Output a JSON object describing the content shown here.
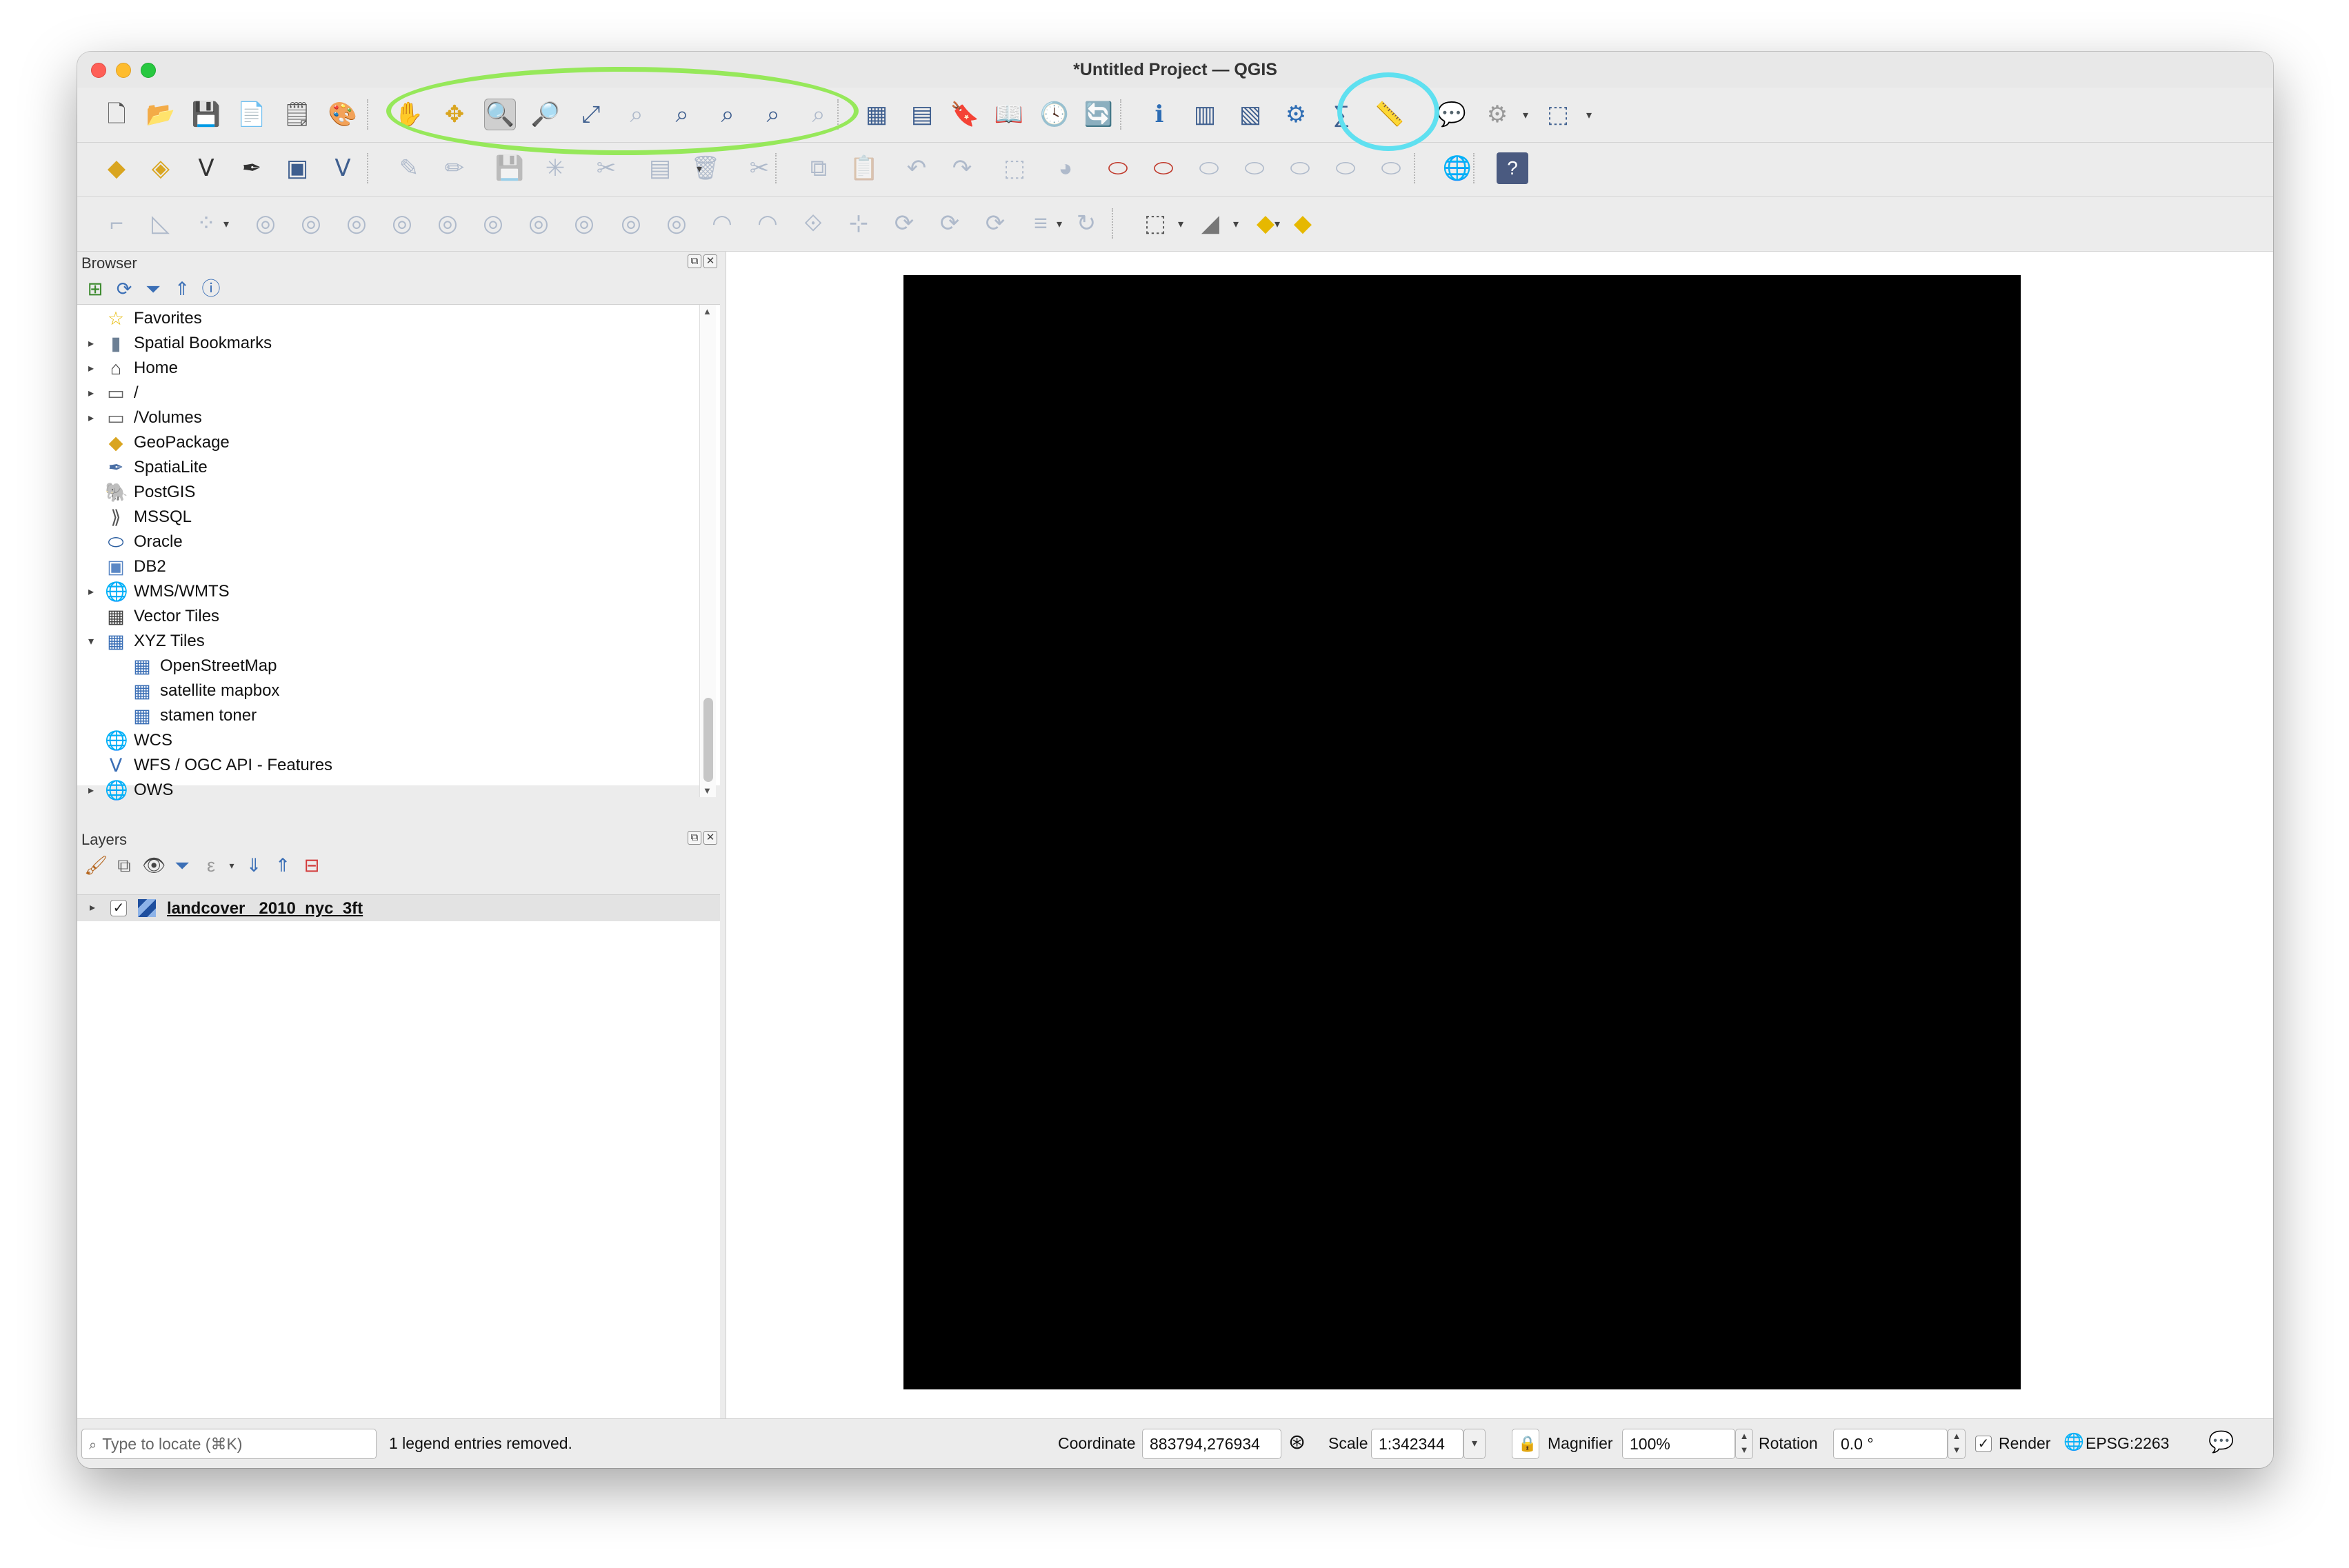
{
  "window": {
    "title": "*Untitled Project — QGIS"
  },
  "toolbar1": {
    "tools": [
      {
        "name": "new-project-icon",
        "glyph": "🗋"
      },
      {
        "name": "open-project-icon",
        "glyph": "📂"
      },
      {
        "name": "save-project-icon",
        "glyph": "💾"
      },
      {
        "name": "new-print-layout-icon",
        "glyph": "📄"
      },
      {
        "name": "layout-manager-icon",
        "glyph": "🗒"
      },
      {
        "name": "style-manager-icon",
        "glyph": "🎨"
      },
      {
        "name": "pan-map-icon",
        "glyph": "✋"
      },
      {
        "name": "pan-to-selection-icon",
        "glyph": "✥"
      },
      {
        "name": "zoom-in-icon",
        "glyph": "🔍"
      },
      {
        "name": "zoom-out-icon",
        "glyph": "🔎"
      },
      {
        "name": "zoom-full-icon",
        "glyph": "⤢"
      },
      {
        "name": "zoom-to-selection-icon",
        "glyph": "⌕"
      },
      {
        "name": "zoom-to-layer-icon",
        "glyph": "⌕"
      },
      {
        "name": "zoom-native-resolution-icon",
        "glyph": "⌕"
      },
      {
        "name": "zoom-last-icon",
        "glyph": "⌕"
      },
      {
        "name": "zoom-next-icon",
        "glyph": "⌕"
      },
      {
        "name": "new-map-view-icon",
        "glyph": "▦"
      },
      {
        "name": "new-3d-map-view-icon",
        "glyph": "▤"
      },
      {
        "name": "new-spatial-bookmark-icon",
        "glyph": "🔖"
      },
      {
        "name": "show-spatial-bookmarks-icon",
        "glyph": "📖"
      },
      {
        "name": "temporal-controller-icon",
        "glyph": "🕓"
      },
      {
        "name": "refresh-icon",
        "glyph": "🔄"
      },
      {
        "name": "identify-features-icon",
        "glyph": "ℹ"
      },
      {
        "name": "open-attribute-table-icon",
        "glyph": "▥"
      },
      {
        "name": "statistical-summary-icon",
        "glyph": "▧"
      },
      {
        "name": "processing-toolbox-icon",
        "glyph": "⚙"
      },
      {
        "name": "calculator-icon",
        "glyph": "∑"
      },
      {
        "name": "measure-line-icon",
        "glyph": "📏"
      },
      {
        "name": "map-tips-icon",
        "glyph": "💬"
      },
      {
        "name": "annotation-icon",
        "glyph": "⚙"
      },
      {
        "name": "select-features-icon",
        "glyph": "⬚"
      }
    ]
  },
  "toolbar2": {
    "tools": [
      {
        "name": "data-source-manager-icon",
        "glyph": "◆"
      },
      {
        "name": "new-geopackage-layer-icon",
        "glyph": "◈"
      },
      {
        "name": "new-shapefile-layer-icon",
        "glyph": "Ⅴ"
      },
      {
        "name": "new-spatialite-layer-icon",
        "glyph": "✒"
      },
      {
        "name": "new-temporary-layer-icon",
        "glyph": "▣"
      },
      {
        "name": "new-virtual-layer-icon",
        "glyph": "Ⅴ"
      },
      {
        "name": "current-edits-icon",
        "glyph": "✎"
      },
      {
        "name": "toggle-editing-icon",
        "glyph": "✏"
      },
      {
        "name": "save-edits-icon",
        "glyph": "💾"
      },
      {
        "name": "digitize-icon",
        "glyph": "✳"
      },
      {
        "name": "vertex-tool-icon",
        "glyph": "✂"
      },
      {
        "name": "modify-attributes-icon",
        "glyph": "▤"
      },
      {
        "name": "delete-selected-icon",
        "glyph": "🗑"
      },
      {
        "name": "cut-features-icon",
        "glyph": "✂"
      },
      {
        "name": "copy-features-icon",
        "glyph": "⧉"
      },
      {
        "name": "paste-features-icon",
        "glyph": "📋"
      },
      {
        "name": "undo-icon",
        "glyph": "↶"
      },
      {
        "name": "redo-icon",
        "glyph": "↷"
      },
      {
        "name": "label-icon",
        "glyph": "⬚"
      },
      {
        "name": "diagram-icon",
        "glyph": "◕"
      },
      {
        "name": "layer-labeling-icon",
        "glyph": "⬭"
      },
      {
        "name": "highlight-pinned-labels-icon",
        "glyph": "⬭"
      },
      {
        "name": "pin-label-icon",
        "glyph": "⬭"
      },
      {
        "name": "show-hide-labels-icon",
        "glyph": "⬭"
      },
      {
        "name": "move-label-icon",
        "glyph": "⬭"
      },
      {
        "name": "rotate-label-icon",
        "glyph": "⬭"
      },
      {
        "name": "change-label-icon",
        "glyph": "⬭"
      },
      {
        "name": "metasearch-icon",
        "glyph": "🌐"
      },
      {
        "name": "help-icon",
        "glyph": "?"
      }
    ]
  },
  "toolbar3": {
    "tools": [
      {
        "name": "advanced-digitizing-icon",
        "glyph": "⌐"
      },
      {
        "name": "enable-snapping-icon",
        "glyph": "◺"
      },
      {
        "name": "add-ring-icon",
        "glyph": "⁘"
      },
      {
        "name": "fill-ring-icon",
        "glyph": "◎"
      },
      {
        "name": "delete-ring-icon",
        "glyph": "◎"
      },
      {
        "name": "add-part-icon",
        "glyph": "◎"
      },
      {
        "name": "delete-part-icon",
        "glyph": "◎"
      },
      {
        "name": "reshape-features-icon",
        "glyph": "◎"
      },
      {
        "name": "offset-curve-icon",
        "glyph": "◎"
      },
      {
        "name": "split-features-icon",
        "glyph": "◎"
      },
      {
        "name": "split-parts-icon",
        "glyph": "◎"
      },
      {
        "name": "merge-selected-icon",
        "glyph": "◎"
      },
      {
        "name": "merge-attributes-icon",
        "glyph": "◎"
      },
      {
        "name": "rotate-point-symbols-icon",
        "glyph": "◠"
      },
      {
        "name": "offset-point-symbols-icon",
        "glyph": "◠"
      },
      {
        "name": "trim-extend-icon",
        "glyph": "⟐"
      },
      {
        "name": "simplify-icon",
        "glyph": "⊹"
      },
      {
        "name": "reverse-line-icon",
        "glyph": "⟳"
      },
      {
        "name": "node-tool-icon",
        "glyph": "⟳"
      },
      {
        "name": "move-feature-icon",
        "glyph": "⟳"
      },
      {
        "name": "copy-move-icon",
        "glyph": "≡"
      },
      {
        "name": "rotate-feature-icon",
        "glyph": "↻"
      },
      {
        "name": "select-by-area-icon",
        "glyph": "⬚"
      },
      {
        "name": "deselect-all-icon",
        "glyph": "◢"
      },
      {
        "name": "select-by-expression-icon",
        "glyph": "◆"
      },
      {
        "name": "feature-action-icon",
        "glyph": "◆"
      }
    ]
  },
  "browser": {
    "title": "Browser",
    "items": [
      {
        "label": "Favorites",
        "icon": "star-icon",
        "glyph": "☆",
        "color": "#e6b800",
        "arrow": "",
        "indent": 0
      },
      {
        "label": "Spatial Bookmarks",
        "icon": "bookmark-icon",
        "glyph": "▮",
        "color": "#6c7f94",
        "arrow": "▸",
        "indent": 0
      },
      {
        "label": "Home",
        "icon": "home-icon",
        "glyph": "⌂",
        "color": "#444444",
        "arrow": "▸",
        "indent": 0
      },
      {
        "label": "/",
        "icon": "folder-icon",
        "glyph": "▭",
        "color": "#666666",
        "arrow": "▸",
        "indent": 0
      },
      {
        "label": "/Volumes",
        "icon": "folder-icon",
        "glyph": "▭",
        "color": "#666666",
        "arrow": "▸",
        "indent": 0
      },
      {
        "label": "GeoPackage",
        "icon": "geopackage-icon",
        "glyph": "◆",
        "color": "#d9a520",
        "arrow": "",
        "indent": 0
      },
      {
        "label": "SpatiaLite",
        "icon": "spatialite-icon",
        "glyph": "✒",
        "color": "#4a6fa5",
        "arrow": "",
        "indent": 0
      },
      {
        "label": "PostGIS",
        "icon": "postgis-icon",
        "glyph": "🐘",
        "color": "#336791",
        "arrow": "",
        "indent": 0
      },
      {
        "label": "MSSQL",
        "icon": "mssql-icon",
        "glyph": "⟫",
        "color": "#555555",
        "arrow": "",
        "indent": 0
      },
      {
        "label": "Oracle",
        "icon": "oracle-icon",
        "glyph": "⬭",
        "color": "#2a5d9f",
        "arrow": "",
        "indent": 0
      },
      {
        "label": "DB2",
        "icon": "db2-icon",
        "glyph": "▣",
        "color": "#5a87c5",
        "arrow": "",
        "indent": 0
      },
      {
        "label": "WMS/WMTS",
        "icon": "wms-icon",
        "glyph": "🌐",
        "color": "#3b6fb6",
        "arrow": "▸",
        "indent": 0
      },
      {
        "label": "Vector Tiles",
        "icon": "vector-tiles-icon",
        "glyph": "▦",
        "color": "#444444",
        "arrow": "",
        "indent": 0
      },
      {
        "label": "XYZ Tiles",
        "icon": "xyz-tiles-icon",
        "glyph": "▦",
        "color": "#3b6fb6",
        "arrow": "▾",
        "indent": 0
      },
      {
        "label": "OpenStreetMap",
        "icon": "tile-grid-icon",
        "glyph": "▦",
        "color": "#3b6fb6",
        "arrow": "",
        "indent": 1
      },
      {
        "label": "satellite mapbox",
        "icon": "tile-grid-icon",
        "glyph": "▦",
        "color": "#3b6fb6",
        "arrow": "",
        "indent": 1
      },
      {
        "label": "stamen toner",
        "icon": "tile-grid-icon",
        "glyph": "▦",
        "color": "#3b6fb6",
        "arrow": "",
        "indent": 1
      },
      {
        "label": "WCS",
        "icon": "wcs-icon",
        "glyph": "🌐",
        "color": "#3b6fb6",
        "arrow": "",
        "indent": 0
      },
      {
        "label": "WFS / OGC API - Features",
        "icon": "wfs-icon",
        "glyph": "Ⅴ",
        "color": "#3b6fb6",
        "arrow": "",
        "indent": 0
      },
      {
        "label": "OWS",
        "icon": "ows-icon",
        "glyph": "🌐",
        "color": "#3b6fb6",
        "arrow": "▸",
        "indent": 0
      }
    ]
  },
  "layers": {
    "title": "Layers",
    "items": [
      {
        "label": "landcover _2010_nyc_3ft",
        "checked": "✓"
      }
    ]
  },
  "statusbar": {
    "locate_placeholder": "Type to locate (⌘K)",
    "message": "1 legend entries removed.",
    "coordinate_label": "Coordinate",
    "coordinate_value": "883794,276934",
    "scale_label": "Scale",
    "scale_value": "1:342344",
    "magnifier_label": "Magnifier",
    "magnifier_value": "100%",
    "rotation_label": "Rotation",
    "rotation_value": "0.0 °",
    "render_label": "Render",
    "render_checked": "✓",
    "crs_label": "EPSG:2263"
  },
  "map_canvas": {
    "layer": "landcover _2010_nyc_3ft"
  }
}
